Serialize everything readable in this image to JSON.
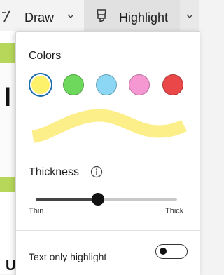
{
  "toolbar": {
    "draw_label": "Draw",
    "highlight_label": "Highlight"
  },
  "panel": {
    "colors_title": "Colors",
    "colors": [
      {
        "name": "yellow",
        "hex": "#fdf16b",
        "selected": true
      },
      {
        "name": "green",
        "hex": "#6ed85c",
        "selected": false
      },
      {
        "name": "light-blue",
        "hex": "#8cd8f4",
        "selected": false
      },
      {
        "name": "pink",
        "hex": "#f597d0",
        "selected": false
      },
      {
        "name": "red",
        "hex": "#ea4848",
        "selected": false
      }
    ],
    "preview_color": "#fcef8a",
    "selection_ring_color": "#1c6ca8",
    "thickness_title": "Thickness",
    "thickness_value": 0.44,
    "thickness_min_label": "Thin",
    "thickness_max_label": "Thick",
    "text_only_label": "Text only highlight",
    "text_only_enabled": false
  },
  "background": {
    "accent_color": "#b7d75b"
  }
}
